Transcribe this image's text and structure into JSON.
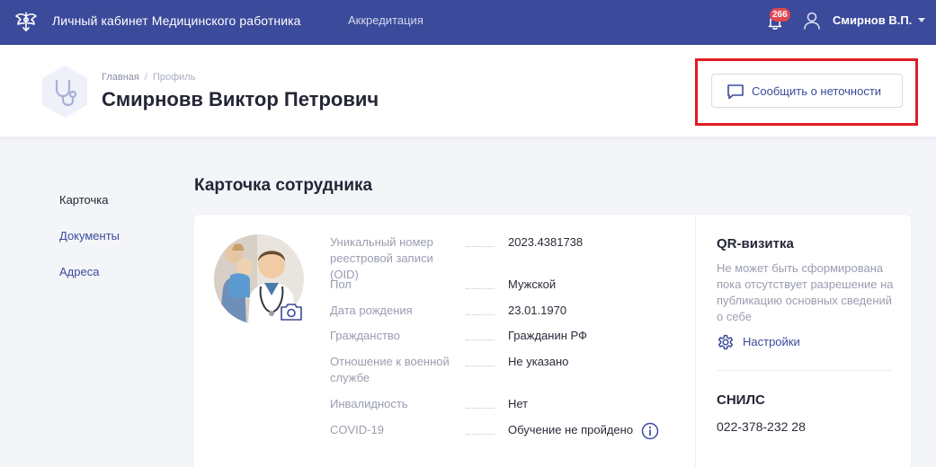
{
  "topbar": {
    "app_title": "Личный кабинет Медицинского работника",
    "nav_link": "Аккредитация",
    "notifications_count": "266",
    "user_name": "Смирнов В.П.",
    "logo_icon": "emblem-eagle-icon",
    "colors": {
      "background": "#3b4a9a",
      "badge": "#e0484f"
    }
  },
  "header": {
    "breadcrumb": {
      "home": "Главная",
      "separator": "/",
      "current": "Профиль"
    },
    "person_name": "Смирновв Виктор Петрович",
    "avatar_icon": "stethoscope-icon",
    "report_button_label": "Сообщить о неточности",
    "report_button_icon": "chat-icon",
    "highlight_color": "#e01b24"
  },
  "side_menu": {
    "items": [
      {
        "label": "Карточка"
      },
      {
        "label": "Документы"
      },
      {
        "label": "Адреса"
      }
    ]
  },
  "section_title": "Карточка сотрудника",
  "employee": {
    "fields": [
      {
        "label_line1": "Уникальный номер",
        "label_line2": "реестровой записи (OID)",
        "value": "2023.4381738"
      },
      {
        "label_line1": "Пол",
        "label_line2": "",
        "value": "Мужской"
      },
      {
        "label_line1": "Дата рождения",
        "label_line2": "",
        "value": "23.01.1970"
      },
      {
        "label_line1": "Гражданство",
        "label_line2": "",
        "value": "Гражданин РФ"
      },
      {
        "label_line1": "Отношение к военной",
        "label_line2": "службе",
        "value": "Не указано"
      },
      {
        "label_line1": "Инвалидность",
        "label_line2": "",
        "value": "Нет"
      },
      {
        "label_line1": "COVID-19",
        "label_line2": "",
        "value": "Обучение не пройдено"
      }
    ]
  },
  "qr": {
    "title": "QR-визитка",
    "text": "Не может быть сформирована пока отсутствует разрешение на публикацию основных сведений о себе",
    "settings_label": "Настройки"
  },
  "snils": {
    "title": "СНИЛС",
    "value": "022-378-232 28"
  }
}
